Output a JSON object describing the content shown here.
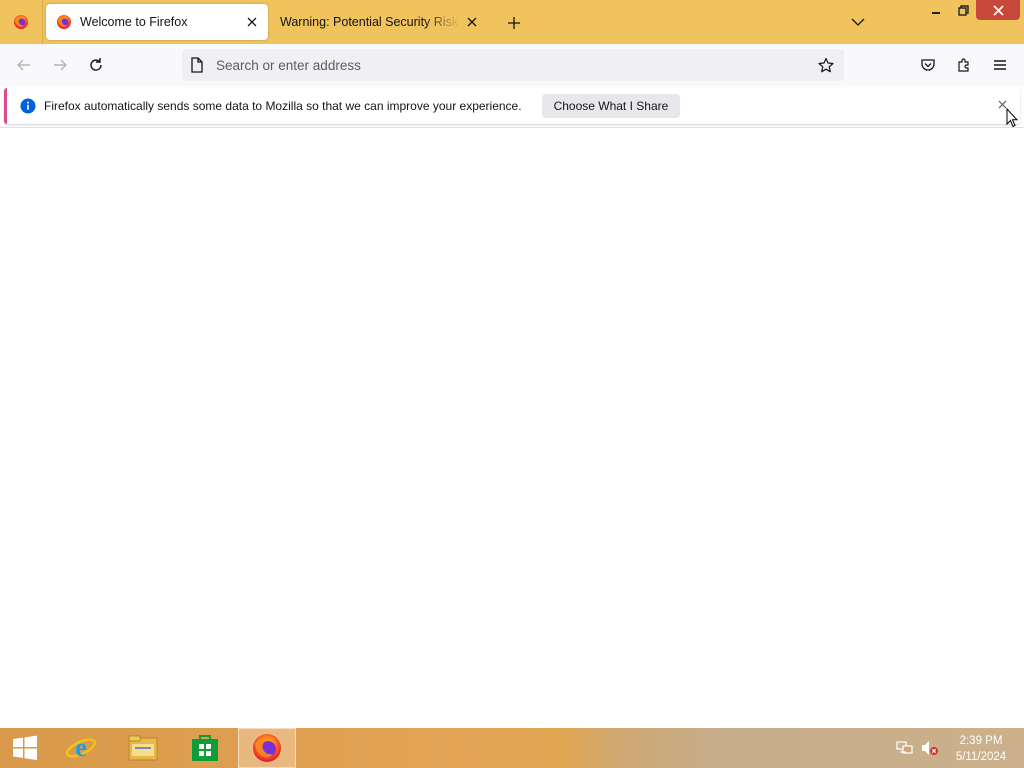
{
  "browser": {
    "tabs": [
      {
        "title": "Welcome to Firefox",
        "active": true
      },
      {
        "title": "Warning: Potential Security Risk Ahead",
        "active": false
      }
    ],
    "address_placeholder": "Search or enter address"
  },
  "notification": {
    "message": "Firefox automatically sends some data to Mozilla so that we can improve your experience.",
    "button_label": "Choose What I Share"
  },
  "taskbar": {
    "time": "2:39 PM",
    "date": "5/11/2024"
  },
  "colors": {
    "tabstrip": "#f0c35c",
    "notification_accent": "#d94d8f",
    "info_blue": "#0060df",
    "close_red": "#c9483c"
  },
  "icons": {
    "firefox": "firefox-logo-icon",
    "warning_tab": "firefox-logo-icon",
    "page": "page-icon",
    "star": "star-outline-icon",
    "pocket": "pocket-icon",
    "extensions": "puzzle-piece-icon",
    "menu": "hamburger-menu-icon"
  }
}
